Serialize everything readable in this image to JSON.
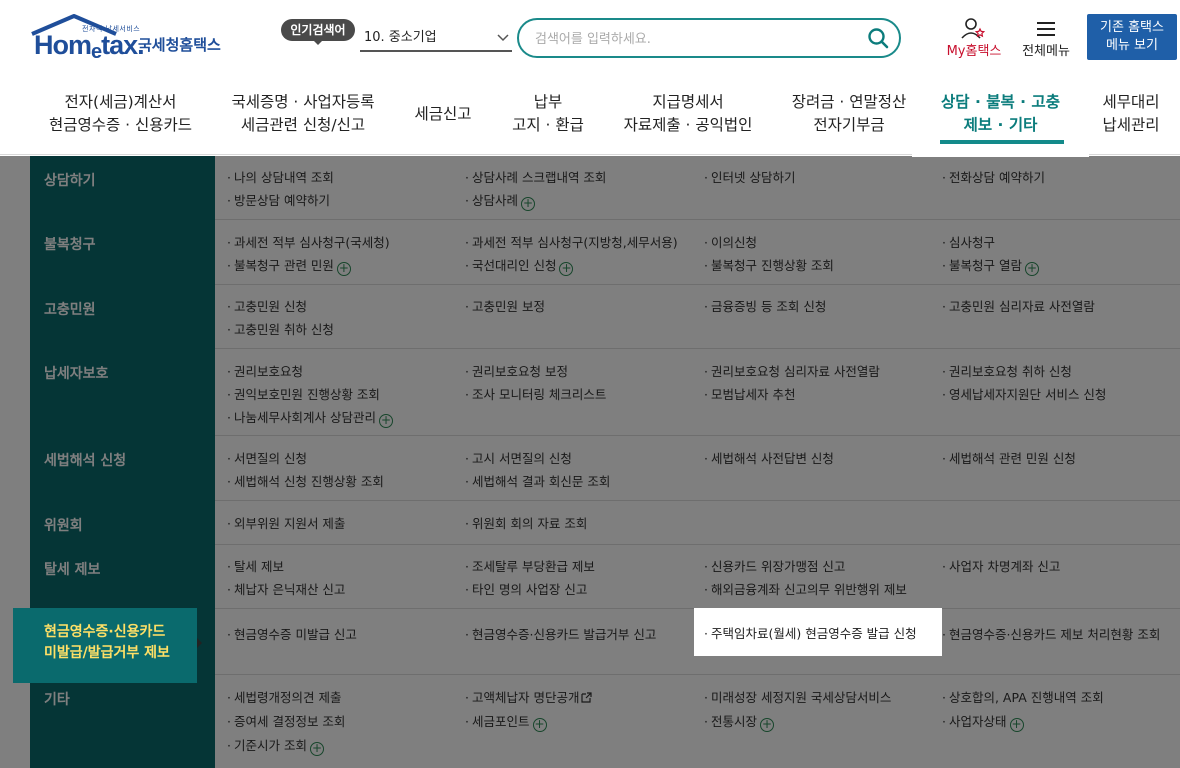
{
  "header": {
    "logo_small": "전자적 납세서비스",
    "logo_word_a": "Hom",
    "logo_word_e": "e",
    "logo_word_b": "tax.",
    "logo_ko": "국세청홈택스",
    "popular_label": "인기검색어",
    "keyword_selected": "10. 중소기업",
    "search_placeholder": "검색어를 입력하세요.",
    "my_home": "My홈택스",
    "all_menu": "전체메뉴",
    "old_home_line1": "기존 홈택스",
    "old_home_line2": "메뉴 보기"
  },
  "topnav": [
    {
      "line1": "전자(세금)계산서",
      "line2": "현금영수증 · 신용카드"
    },
    {
      "line1": "국세증명 · 사업자등록",
      "line2": "세금관련 신청/신고"
    },
    {
      "line1": "세금신고",
      "line2": ""
    },
    {
      "line1": "납부",
      "line2": "고지 · 환급"
    },
    {
      "line1": "지급명세서",
      "line2": "자료제출 · 공익법인"
    },
    {
      "line1": "장려금 · 연말정산",
      "line2": "전자기부금"
    },
    {
      "line1": "상담 · 불복 · 고충",
      "line2": "제보 · 기타"
    },
    {
      "line1": "세무대리",
      "line2": "납세관리"
    }
  ],
  "rows": [
    {
      "cat": "상담하기",
      "links": [
        [
          "나의 상담내역 조회",
          "방문상담 예약하기"
        ],
        [
          "상담사례 스크랩내역 조회",
          "상담사례"
        ],
        [
          "인터넷 상담하기"
        ],
        [
          "전화상담 예약하기"
        ]
      ]
    },
    {
      "cat": "불복청구",
      "links": [
        [
          "과세전 적부 심사청구(국세청)",
          "불복청구 관련 민원"
        ],
        [
          "과세전 적부 심사청구(지방청,세무서용)",
          "국선대리인 신청"
        ],
        [
          "이의신청",
          "불복청구 진행상황 조회"
        ],
        [
          "심사청구",
          "불복청구 열람"
        ]
      ]
    },
    {
      "cat": "고충민원",
      "links": [
        [
          "고충민원 신청",
          "고충민원 취하 신청"
        ],
        [
          "고충민원 보정"
        ],
        [
          "금융증빙 등 조회 신청"
        ],
        [
          "고충민원 심리자료 사전열람"
        ]
      ]
    },
    {
      "cat": "납세자보호",
      "links": [
        [
          "권리보호요청",
          "권익보호민원 진행상황 조회",
          "나눔세무사회계사 상담관리"
        ],
        [
          "권리보호요청 보정",
          "조사 모니터링 체크리스트"
        ],
        [
          "권리보호요청 심리자료 사전열람",
          "모범납세자 추천"
        ],
        [
          "권리보호요청 취하 신청",
          "영세납세자지원단 서비스 신청"
        ]
      ]
    },
    {
      "cat": "세법해석 신청",
      "links": [
        [
          "서면질의 신청",
          "세법해석 신청 진행상황 조회"
        ],
        [
          "고시 서면질의 신청",
          "세법해석 결과 회신문 조회"
        ],
        [
          "세법해석 사전답변 신청"
        ],
        [
          "세법해석 관련 민원 신청"
        ]
      ]
    },
    {
      "cat": "위원회",
      "links": [
        [
          "외부위원 지원서 제출"
        ],
        [
          "위원회 회의 자료 조회"
        ],
        [],
        []
      ]
    },
    {
      "cat": "탈세 제보",
      "links": [
        [
          "탈세 제보",
          "체납자 은닉재산 신고"
        ],
        [
          "조세탈루 부당환급 제보",
          "타인 명의 사업장 신고"
        ],
        [
          "신용카드 위장가맹점 신고",
          "해외금융계좌 신고의무 위반행위 제보"
        ],
        [
          "사업자 차명계좌 신고"
        ]
      ]
    },
    {
      "cat": "현금영수증·신용카드 미발급/발급거부 제보",
      "cat_line1": "현금영수증·신용카드",
      "cat_line2": "미발급/발급거부 제보",
      "links": [
        [
          "현금영수증 미발급 신고"
        ],
        [
          "현금영수증·신용카드 발급거부 신고"
        ],
        [
          "주택임차료(월세) 현금영수증 발급 신청"
        ],
        [
          "현금영수증·신용카드 제보 처리현황 조회"
        ]
      ]
    },
    {
      "cat": "기타",
      "links": [
        [
          "세법령개정의견 제출",
          "증여세 결정정보 조회",
          "기준시가 조회"
        ],
        [
          "고액체납자 명단공개",
          "세금포인트"
        ],
        [
          "미래성장 세정지원 국세상담서비스",
          "전통시장"
        ],
        [
          "상호합의, APA 진행내역 조회",
          "사업자상태"
        ]
      ]
    }
  ]
}
